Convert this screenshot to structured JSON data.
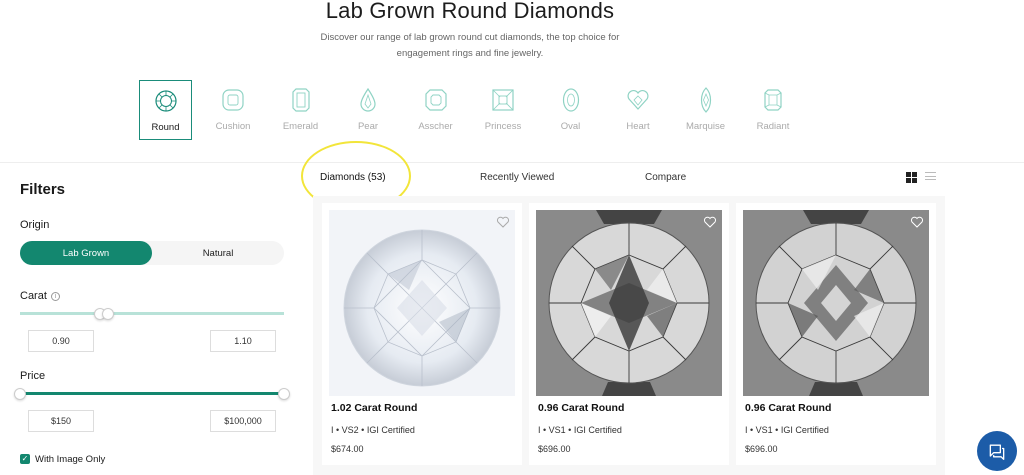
{
  "header": {
    "title": "Lab Grown Round Diamonds",
    "subtitle": "Discover our range of lab grown round cut diamonds, the top choice for engagement rings and fine jewelry."
  },
  "shapes": [
    {
      "label": "Round",
      "icon": "round-shape-icon",
      "active": true
    },
    {
      "label": "Cushion",
      "icon": "cushion-shape-icon"
    },
    {
      "label": "Emerald",
      "icon": "emerald-shape-icon"
    },
    {
      "label": "Pear",
      "icon": "pear-shape-icon"
    },
    {
      "label": "Asscher",
      "icon": "asscher-shape-icon"
    },
    {
      "label": "Princess",
      "icon": "princess-shape-icon"
    },
    {
      "label": "Oval",
      "icon": "oval-shape-icon"
    },
    {
      "label": "Heart",
      "icon": "heart-shape-icon"
    },
    {
      "label": "Marquise",
      "icon": "marquise-shape-icon"
    },
    {
      "label": "Radiant",
      "icon": "radiant-shape-icon"
    }
  ],
  "filters": {
    "heading": "Filters",
    "origin": {
      "label": "Origin",
      "options": [
        "Lab Grown",
        "Natural"
      ],
      "selected": "Lab Grown"
    },
    "carat": {
      "label": "Carat",
      "min": "0.90",
      "max": "1.10"
    },
    "price": {
      "label": "Price",
      "min": "$150",
      "max": "$100,000"
    },
    "image_only": {
      "label": "With Image Only",
      "checked": true
    }
  },
  "tabs": [
    {
      "label": "Diamonds (53)",
      "active": true
    },
    {
      "label": "Recently Viewed"
    },
    {
      "label": "Compare"
    }
  ],
  "products": [
    {
      "name": "1.02 Carat Round",
      "spec": "I • VS2 • IGI Certified",
      "price": "$674.00"
    },
    {
      "name": "0.96 Carat Round",
      "spec": "I • VS1 • IGI Certified",
      "price": "$696.00"
    },
    {
      "name": "0.96 Carat Round",
      "spec": "I • VS1 • IGI Certified",
      "price": "$696.00"
    }
  ],
  "colors": {
    "accent": "#13876f",
    "highlight": "#f2e53a",
    "chat": "#1c5ca8"
  }
}
